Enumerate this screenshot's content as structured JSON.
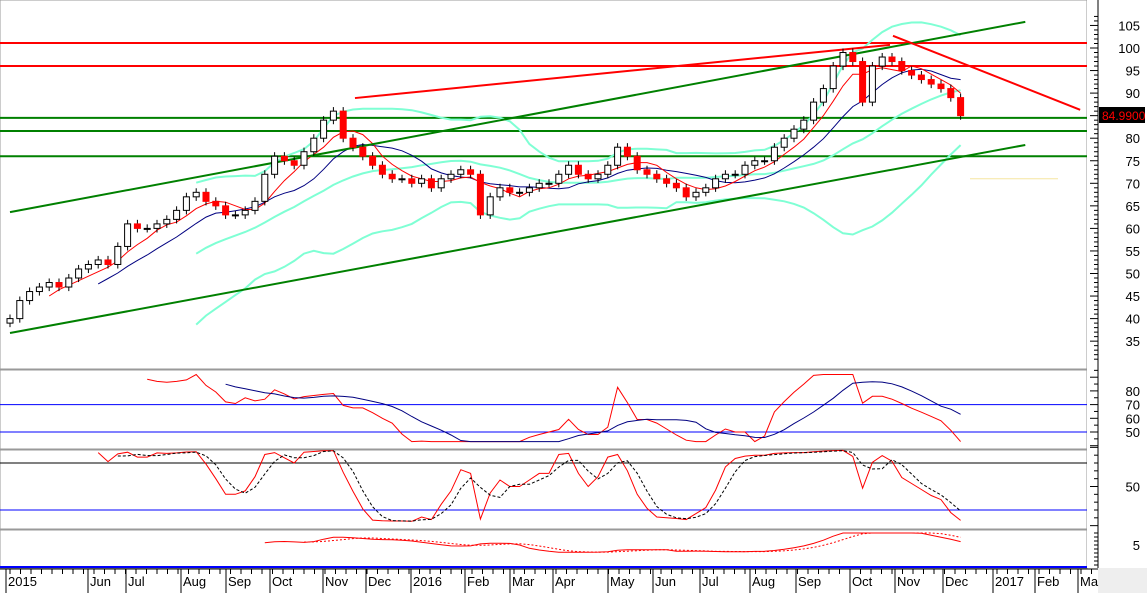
{
  "chart_data": {
    "type": "candlestick",
    "title": "",
    "last_price_label": "84.9900",
    "x_ticks": [
      "2015",
      "Jun",
      "Jul",
      "Aug",
      "Sep",
      "Oct",
      "Nov",
      "Dec",
      "2016",
      "Feb",
      "Mar",
      "Apr",
      "May",
      "Jun",
      "Jul",
      "Aug",
      "Sep",
      "Oct",
      "Nov",
      "Dec",
      "2017",
      "Feb",
      "Ma"
    ],
    "price_axis": {
      "ylim": [
        30,
        107
      ],
      "ticks": [
        "105",
        "100",
        "95",
        "90",
        "85",
        "80",
        "75",
        "70",
        "65",
        "60",
        "55",
        "50",
        "45",
        "40",
        "35"
      ]
    },
    "weekly_closes": [
      40,
      44,
      46,
      47,
      48,
      47,
      49,
      51,
      52,
      53,
      52,
      56,
      61,
      60,
      60,
      61,
      62,
      64,
      67,
      68,
      66,
      65,
      63,
      63,
      64,
      66,
      72,
      76,
      75,
      74,
      77,
      80,
      84,
      86,
      80,
      78,
      76,
      74,
      72,
      71,
      71,
      70,
      71,
      69,
      71,
      72,
      73,
      72,
      63,
      67,
      69,
      68,
      68,
      69,
      70,
      70,
      72,
      74,
      72,
      71,
      72,
      74,
      78,
      76,
      73,
      72,
      71,
      70,
      69,
      67,
      68,
      69,
      71,
      72,
      72,
      74,
      75,
      75,
      78,
      80,
      82,
      84,
      88,
      91,
      96,
      99,
      97,
      88,
      96,
      98,
      97,
      95,
      94,
      93,
      92,
      91,
      89,
      85
    ],
    "horizontal_levels": [
      {
        "price": 101.1,
        "color": "#ff0000"
      },
      {
        "price": 96.0,
        "color": "#ff0000"
      },
      {
        "price": 84.5,
        "color": "#008000"
      },
      {
        "price": 81.6,
        "color": "#008000"
      },
      {
        "price": 76.0,
        "color": "#008000"
      }
    ],
    "trendlines": [
      {
        "name": "lower-channel",
        "color": "#008000",
        "from": [
          0,
          36.8
        ],
        "to": [
          103.6,
          78.5
        ]
      },
      {
        "name": "upper-channel",
        "color": "#008000",
        "from": [
          0,
          63.6
        ],
        "to": [
          103.6,
          105.8
        ]
      },
      {
        "name": "red-resistance",
        "color": "#ff0000",
        "from": [
          35.2,
          88.9
        ],
        "to": [
          89.8,
          100.7
        ]
      },
      {
        "name": "red-downtrend",
        "color": "#ff0000",
        "from": [
          90.1,
          102.7
        ],
        "to": [
          109.2,
          86.3
        ]
      }
    ],
    "indicators": {
      "rsi_panel": {
        "ticks": [
          "80",
          "70",
          "60",
          "50"
        ],
        "levels": [
          70,
          50
        ]
      },
      "stochastic_panel": {
        "ticks": [
          "50"
        ],
        "levels": [
          80,
          20
        ]
      },
      "volatility_panel": {
        "ticks": [
          "5"
        ]
      }
    },
    "colors": {
      "up": "#ffffff",
      "down": "#ff0000",
      "ma_fast": "#ff0000",
      "ma_slow": "#000080",
      "bands": "#7fffd4",
      "level_line": "#0000ff"
    }
  }
}
